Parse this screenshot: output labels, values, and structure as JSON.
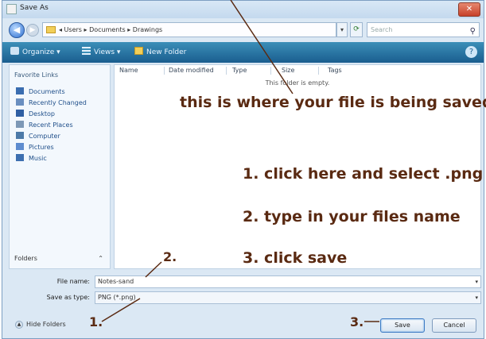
{
  "window": {
    "title": "Save As",
    "close_glyph": "✕"
  },
  "address": {
    "path": "◂ Users ▸ Documents ▸ Drawings",
    "search_placeholder": "Search"
  },
  "toolbar": {
    "organize": "Organize ▾",
    "views": "Views ▾",
    "new_folder": "New Folder"
  },
  "nav": {
    "header": "Favorite Links",
    "items": [
      {
        "label": "Documents",
        "color": "#3a6db0"
      },
      {
        "label": "Recently Changed",
        "color": "#6a8fc0"
      },
      {
        "label": "Desktop",
        "color": "#2f5fa3"
      },
      {
        "label": "Recent Places",
        "color": "#7d98b6"
      },
      {
        "label": "Computer",
        "color": "#4d7aa8"
      },
      {
        "label": "Pictures",
        "color": "#5e8ccf"
      },
      {
        "label": "Music",
        "color": "#3d6fb0"
      }
    ],
    "folders_label": "Folders",
    "folders_chevron": "⌃"
  },
  "columns": [
    "Name",
    "Date modified",
    "Type",
    "Size",
    "Tags"
  ],
  "empty_message": "This folder is empty.",
  "form": {
    "filename_label": "File name:",
    "filename_value": "Notes-sand",
    "savetype_label": "Save as type:",
    "savetype_value": "PNG (*.png)"
  },
  "buttons": {
    "hide_folders": "Hide Folders",
    "save": "Save",
    "cancel": "Cancel"
  },
  "annotations": {
    "saved_location": "this is where your file is being saved",
    "step1": "1. click here and select .png",
    "step2": "2. type in your files name",
    "step3": "3. click save",
    "marker1": "1.",
    "marker2": "2.",
    "marker3": "3."
  },
  "colors": {
    "annotation": "#5a2a12",
    "toolbar": "#1a5d8f"
  }
}
